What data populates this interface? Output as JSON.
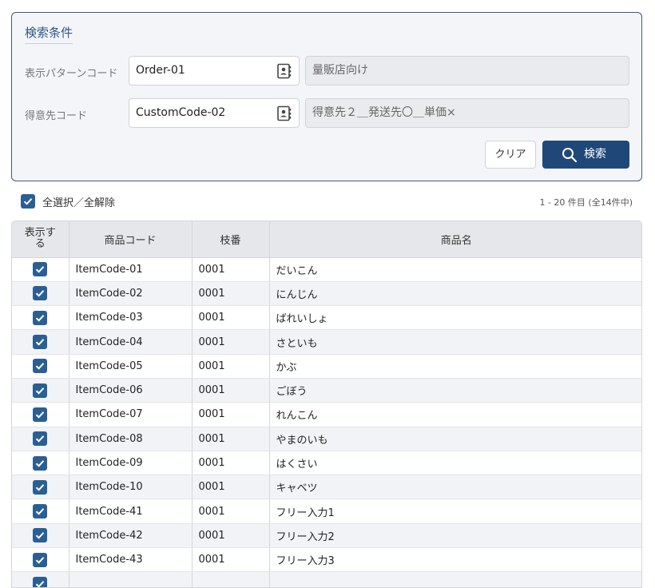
{
  "search_panel": {
    "title": "検索条件",
    "pattern_label": "表示パターンコード",
    "pattern_value": "Order-01",
    "pattern_name": "量販店向け",
    "customer_label": "得意先コード",
    "customer_value": "CustomCode-02",
    "customer_name": "得意先２＿発送先〇＿単価×",
    "clear_label": "クリア",
    "search_label": "検索"
  },
  "list": {
    "select_all_label": "全選択／全解除",
    "page_info": "1 - 20 件目 (全14件中)",
    "columns": [
      "表示する",
      "商品コード",
      "枝番",
      "商品名"
    ],
    "rows": [
      {
        "code": "ItemCode-01",
        "branch": "0001",
        "name": "だいこん",
        "checked": true
      },
      {
        "code": "ItemCode-02",
        "branch": "0001",
        "name": "にんじん",
        "checked": true
      },
      {
        "code": "ItemCode-03",
        "branch": "0001",
        "name": "ばれいしょ",
        "checked": true
      },
      {
        "code": "ItemCode-04",
        "branch": "0001",
        "name": "さといも",
        "checked": true
      },
      {
        "code": "ItemCode-05",
        "branch": "0001",
        "name": "かぶ",
        "checked": true
      },
      {
        "code": "ItemCode-06",
        "branch": "0001",
        "name": "ごぼう",
        "checked": true
      },
      {
        "code": "ItemCode-07",
        "branch": "0001",
        "name": "れんこん",
        "checked": true
      },
      {
        "code": "ItemCode-08",
        "branch": "0001",
        "name": "やまのいも",
        "checked": true
      },
      {
        "code": "ItemCode-09",
        "branch": "0001",
        "name": "はくさい",
        "checked": true
      },
      {
        "code": "ItemCode-10",
        "branch": "0001",
        "name": "キャベツ",
        "checked": true
      },
      {
        "code": "ItemCode-41",
        "branch": "0001",
        "name": "フリー入力1",
        "checked": true
      },
      {
        "code": "ItemCode-42",
        "branch": "0001",
        "name": "フリー入力2",
        "checked": true
      },
      {
        "code": "ItemCode-43",
        "branch": "0001",
        "name": "フリー入力3",
        "checked": true
      },
      {
        "code": "",
        "branch": "",
        "name": "",
        "checked": true
      }
    ]
  },
  "colors": {
    "primary": "#1f4878",
    "checkbox": "#2a5f93",
    "panel_border": "#3d5a80"
  }
}
